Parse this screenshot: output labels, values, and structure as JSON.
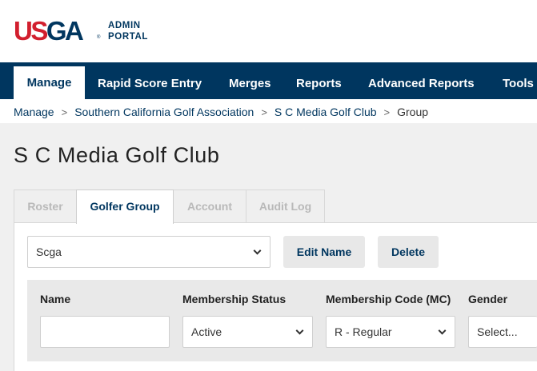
{
  "brand": {
    "logo_us": "US",
    "logo_ga": "GA",
    "reg_mark": "®",
    "portal_line1": "ADMIN",
    "portal_line2": "PORTAL"
  },
  "nav": {
    "items": [
      "Manage",
      "Rapid Score Entry",
      "Merges",
      "Reports",
      "Advanced Reports",
      "Tools"
    ],
    "active": "Manage"
  },
  "breadcrumb": {
    "items": [
      "Manage",
      "Southern California Golf Association",
      "S C Media Golf Club"
    ],
    "current": "Group",
    "separator": ">"
  },
  "page": {
    "title": "S C Media Golf Club"
  },
  "tabs": [
    "Roster",
    "Golfer Group",
    "Account",
    "Audit Log"
  ],
  "active_tab": "Golfer Group",
  "group": {
    "selected": "Scga",
    "edit_label": "Edit Name",
    "delete_label": "Delete"
  },
  "filters": {
    "name_label": "Name",
    "name_value": "",
    "status_label": "Membership Status",
    "status_value": "Active",
    "code_label": "Membership Code (MC)",
    "code_value": "R - Regular",
    "gender_label": "Gender",
    "gender_value": "Select..."
  },
  "colors": {
    "brand_navy": "#00365f",
    "brand_red": "#d21f2e",
    "background": "#f0f0f0"
  }
}
